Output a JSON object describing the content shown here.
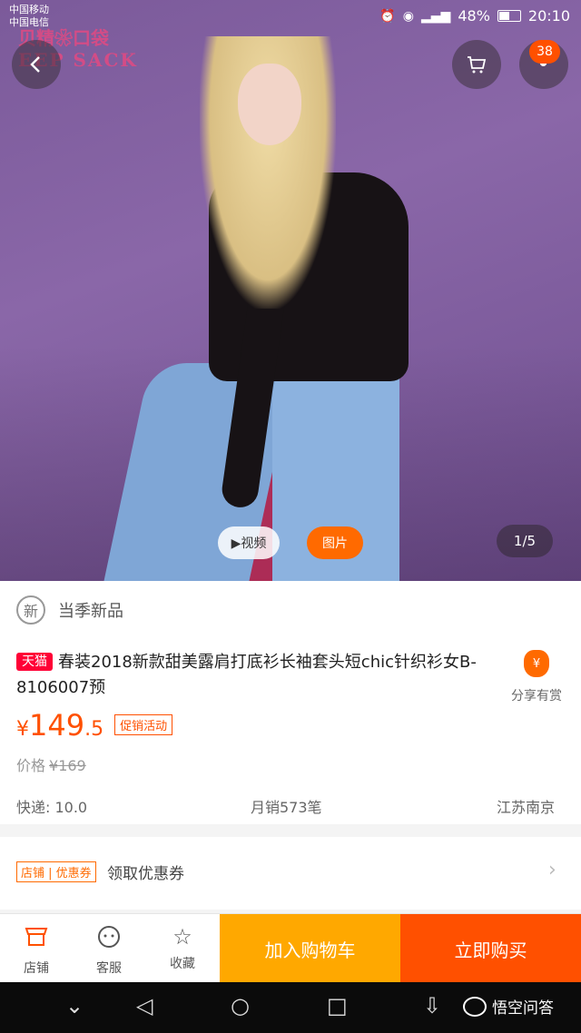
{
  "status_bar": {
    "carrier1": "中国移动",
    "carrier2": "中国电信",
    "battery": "48%",
    "time": "20:10",
    "icons": [
      "alarm-icon",
      "eye-icon",
      "signal-icon",
      "battery-icon"
    ]
  },
  "hero": {
    "brand_line1": "贝精❀口袋",
    "brand_line2": "EEP SACK",
    "cart_badge": "38",
    "video_label": "▶视频",
    "image_label": "图片",
    "counter": "1/5"
  },
  "product": {
    "season_icon_text": "新",
    "season_label": "当季新品",
    "tmall_badge": "天猫",
    "title": "春装2018新款甜美露肩打底衫长袖套头短chic针织衫女B-8106007预",
    "share_label": "分享有赏",
    "price_currency": "¥",
    "price_int": "149",
    "price_dec": ".5",
    "promo_tag": "促销活动",
    "orig_label": "价格",
    "orig_price": "¥169",
    "shipping": "快递: 10.0",
    "monthly_sales": "月销573笔",
    "location": "江苏南京"
  },
  "coupon": {
    "tag": "店铺 | 优惠券",
    "label": "领取优惠券",
    "chevron": "›"
  },
  "bottom_bar": {
    "store": "店铺",
    "service": "客服",
    "favorite": "收藏",
    "add_to_cart": "加入购物车",
    "buy_now": "立即购买"
  },
  "system_nav": {
    "watermark": "悟空问答"
  },
  "colors": {
    "accent": "#ff5000",
    "cart_button": "#ffa800",
    "tmall_red": "#ff0036"
  }
}
